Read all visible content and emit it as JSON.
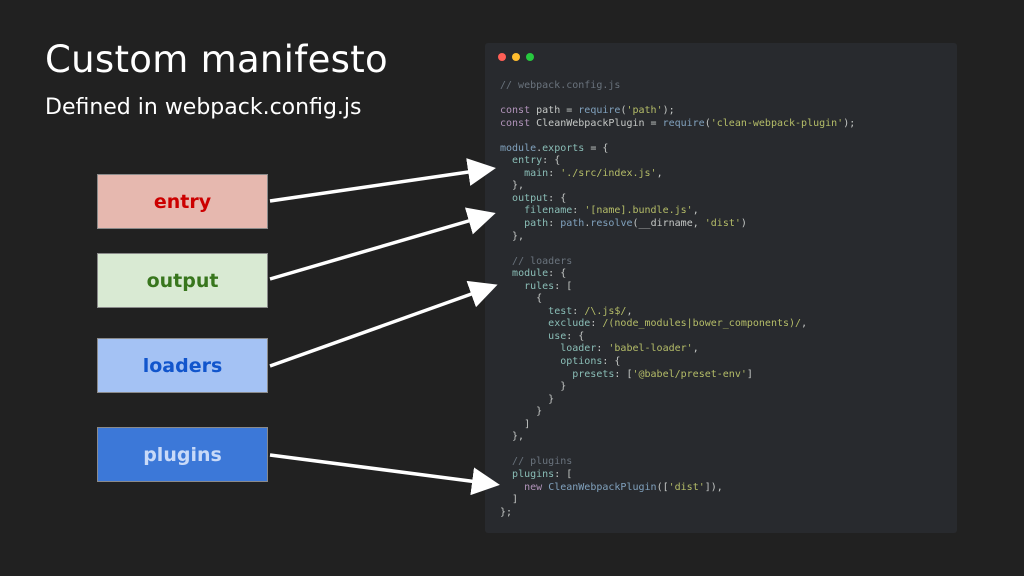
{
  "slide": {
    "title": "Custom manifesto",
    "subtitle": "Defined in webpack.config.js"
  },
  "labels": [
    {
      "id": "entry",
      "text": "entry",
      "bg": "#e6b8af",
      "color": "#cc0000"
    },
    {
      "id": "output",
      "text": "output",
      "bg": "#d9ead3",
      "color": "#38761d"
    },
    {
      "id": "loaders",
      "text": "loaders",
      "bg": "#a4c2f4",
      "color": "#1155cc"
    },
    {
      "id": "plugins",
      "text": "plugins",
      "bg": "#3c78d8",
      "color": "#c9daf8"
    }
  ],
  "editor": {
    "window_buttons": [
      "close-dot",
      "minimize-dot",
      "maximize-dot"
    ],
    "code_lines": [
      [
        [
          "c",
          "// webpack.config.js"
        ]
      ],
      [],
      [
        [
          "k",
          "const"
        ],
        [
          "t",
          " path = "
        ],
        [
          "f",
          "require"
        ],
        [
          "t",
          "("
        ],
        [
          "s",
          "'path'"
        ],
        [
          "t",
          ");"
        ]
      ],
      [
        [
          "k",
          "const"
        ],
        [
          "t",
          " CleanWebpackPlugin = "
        ],
        [
          "f",
          "require"
        ],
        [
          "t",
          "("
        ],
        [
          "s",
          "'clean-webpack-plugin'"
        ],
        [
          "t",
          ");"
        ]
      ],
      [],
      [
        [
          "f",
          "module"
        ],
        [
          "t",
          "."
        ],
        [
          "p",
          "exports"
        ],
        [
          "t",
          " = {"
        ]
      ],
      [
        [
          "t",
          "  "
        ],
        [
          "p",
          "entry"
        ],
        [
          "t",
          ": {"
        ]
      ],
      [
        [
          "t",
          "    "
        ],
        [
          "p",
          "main"
        ],
        [
          "t",
          ": "
        ],
        [
          "s",
          "'./src/index.js'"
        ],
        [
          "t",
          ","
        ]
      ],
      [
        [
          "t",
          "  },"
        ]
      ],
      [
        [
          "t",
          "  "
        ],
        [
          "p",
          "output"
        ],
        [
          "t",
          ": {"
        ]
      ],
      [
        [
          "t",
          "    "
        ],
        [
          "p",
          "filename"
        ],
        [
          "t",
          ": "
        ],
        [
          "s",
          "'[name].bundle.js'"
        ],
        [
          "t",
          ","
        ]
      ],
      [
        [
          "t",
          "    "
        ],
        [
          "p",
          "path"
        ],
        [
          "t",
          ": "
        ],
        [
          "f",
          "path"
        ],
        [
          "t",
          "."
        ],
        [
          "f",
          "resolve"
        ],
        [
          "t",
          "(__dirname, "
        ],
        [
          "s",
          "'dist'"
        ],
        [
          "t",
          ")"
        ]
      ],
      [
        [
          "t",
          "  },"
        ]
      ],
      [],
      [
        [
          "t",
          "  "
        ],
        [
          "c",
          "// loaders"
        ]
      ],
      [
        [
          "t",
          "  "
        ],
        [
          "p",
          "module"
        ],
        [
          "t",
          ": {"
        ]
      ],
      [
        [
          "t",
          "    "
        ],
        [
          "p",
          "rules"
        ],
        [
          "t",
          ": ["
        ]
      ],
      [
        [
          "t",
          "      {"
        ]
      ],
      [
        [
          "t",
          "        "
        ],
        [
          "p",
          "test"
        ],
        [
          "t",
          ": "
        ],
        [
          "s",
          "/\\.js$/"
        ],
        [
          "t",
          ","
        ]
      ],
      [
        [
          "t",
          "        "
        ],
        [
          "p",
          "exclude"
        ],
        [
          "t",
          ": "
        ],
        [
          "s",
          "/(node_modules|bower_components)/"
        ],
        [
          "t",
          ","
        ]
      ],
      [
        [
          "t",
          "        "
        ],
        [
          "p",
          "use"
        ],
        [
          "t",
          ": {"
        ]
      ],
      [
        [
          "t",
          "          "
        ],
        [
          "p",
          "loader"
        ],
        [
          "t",
          ": "
        ],
        [
          "s",
          "'babel-loader'"
        ],
        [
          "t",
          ","
        ]
      ],
      [
        [
          "t",
          "          "
        ],
        [
          "p",
          "options"
        ],
        [
          "t",
          ": {"
        ]
      ],
      [
        [
          "t",
          "            "
        ],
        [
          "p",
          "presets"
        ],
        [
          "t",
          ": ["
        ],
        [
          "s",
          "'@babel/preset-env'"
        ],
        [
          "t",
          "]"
        ]
      ],
      [
        [
          "t",
          "          }"
        ]
      ],
      [
        [
          "t",
          "        }"
        ]
      ],
      [
        [
          "t",
          "      }"
        ]
      ],
      [
        [
          "t",
          "    ]"
        ]
      ],
      [
        [
          "t",
          "  },"
        ]
      ],
      [],
      [
        [
          "t",
          "  "
        ],
        [
          "c",
          "// plugins"
        ]
      ],
      [
        [
          "t",
          "  "
        ],
        [
          "p",
          "plugins"
        ],
        [
          "t",
          ": ["
        ]
      ],
      [
        [
          "t",
          "    "
        ],
        [
          "k",
          "new"
        ],
        [
          "t",
          " "
        ],
        [
          "f",
          "CleanWebpackPlugin"
        ],
        [
          "t",
          "(["
        ],
        [
          "s",
          "'dist'"
        ],
        [
          "t",
          "]),"
        ]
      ],
      [
        [
          "t",
          "  ]"
        ]
      ],
      [
        [
          "t",
          "};"
        ]
      ]
    ]
  },
  "colors": {
    "background": "#212121",
    "editor_bg": "#282a2e",
    "arrow": "#ffffff"
  }
}
